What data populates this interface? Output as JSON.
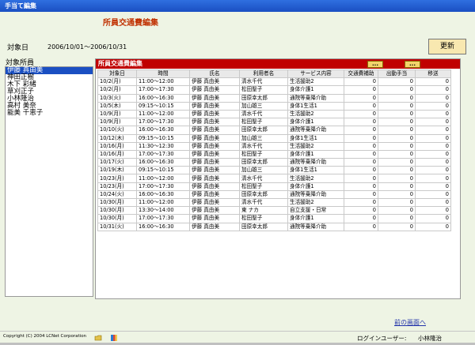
{
  "window": {
    "title": "手当て編集"
  },
  "page_title": "所員交通費編集",
  "period": {
    "label": "対象日",
    "value": "2006/10/01～2006/10/31"
  },
  "update_button": "更新",
  "staff": {
    "label": "対象所員",
    "items": [
      "伊藤 真由美",
      "神田正樹",
      "木下 彩緒",
      "草刈正子",
      "小林隆治",
      "高村 美奈",
      "能美 千恵子"
    ],
    "selected_index": 0
  },
  "panel": {
    "title": "所員交通費編集",
    "dots1": "...",
    "dots2": "..."
  },
  "table": {
    "headers": [
      "対象日",
      "時間",
      "氏名",
      "利用者名",
      "サービス内容",
      "交通費補助",
      "出動手当",
      "移送"
    ],
    "rows": [
      [
        "10/2(月)",
        "11:00～12:00",
        "伊藤 真由美",
        "清水千代",
        "生活援助2",
        "0",
        "0",
        "0"
      ],
      [
        "10/2(月)",
        "17:00～17:30",
        "伊藤 真由美",
        "松田聖子",
        "身体介護1",
        "0",
        "0",
        "0"
      ],
      [
        "10/3(火)",
        "16:00～16:30",
        "伊藤 真由美",
        "田原幸太郎",
        "通院等乗降介助",
        "0",
        "0",
        "0"
      ],
      [
        "10/5(木)",
        "09:15～10:15",
        "伊藤 真由美",
        "加山雄三",
        "身体1生活1",
        "0",
        "0",
        "0"
      ],
      [
        "10/9(月)",
        "11:00～12:00",
        "伊藤 真由美",
        "清水千代",
        "生活援助2",
        "0",
        "0",
        "0"
      ],
      [
        "10/9(月)",
        "17:00～17:30",
        "伊藤 真由美",
        "松田聖子",
        "身体介護1",
        "0",
        "0",
        "0"
      ],
      [
        "10/10(火)",
        "16:00～16:30",
        "伊藤 真由美",
        "田原幸太郎",
        "通院等乗降介助",
        "0",
        "0",
        "0"
      ],
      [
        "10/12(木)",
        "09:15～10:15",
        "伊藤 真由美",
        "加山雄三",
        "身体1生活1",
        "0",
        "0",
        "0"
      ],
      [
        "10/16(月)",
        "11:30～12:30",
        "伊藤 真由美",
        "清水千代",
        "生活援助2",
        "0",
        "0",
        "0"
      ],
      [
        "10/16(月)",
        "17:00～17:30",
        "伊藤 真由美",
        "松田聖子",
        "身体介護1",
        "0",
        "0",
        "0"
      ],
      [
        "10/17(火)",
        "16:00～16:30",
        "伊藤 真由美",
        "田原幸太郎",
        "通院等乗降介助",
        "0",
        "0",
        "0"
      ],
      [
        "10/19(木)",
        "09:15～10:15",
        "伊藤 真由美",
        "加山雄三",
        "身体1生活1",
        "0",
        "0",
        "0"
      ],
      [
        "10/23(月)",
        "11:00～12:00",
        "伊藤 真由美",
        "清水千代",
        "生活援助2",
        "0",
        "0",
        "0"
      ],
      [
        "10/23(月)",
        "17:00～17:30",
        "伊藤 真由美",
        "松田聖子",
        "身体介護1",
        "0",
        "0",
        "0"
      ],
      [
        "10/24(火)",
        "16:00～16:30",
        "伊藤 真由美",
        "田原幸太郎",
        "通院等乗降介助",
        "0",
        "0",
        "0"
      ],
      [
        "10/30(月)",
        "11:00～12:00",
        "伊藤 真由美",
        "清水千代",
        "生活援助2",
        "0",
        "0",
        "0"
      ],
      [
        "10/30(月)",
        "13:30～14:00",
        "伊藤 真由美",
        "東 ナカ",
        "自立支援・日常",
        "0",
        "0",
        "0"
      ],
      [
        "10/30(月)",
        "17:00～17:30",
        "伊藤 真由美",
        "松田聖子",
        "身体介護1",
        "0",
        "0",
        "0"
      ],
      [
        "10/31(火)",
        "16:00～16:30",
        "伊藤 真由美",
        "田原幸太郎",
        "通院等乗降介助",
        "0",
        "0",
        "0"
      ]
    ]
  },
  "footer": {
    "copyright": "Copyright (C) 2004 LCNet Corporation",
    "prev_link": "前の画面へ",
    "login_label": "ログインユーザー:",
    "login_user": "小林隆治"
  },
  "icons": {
    "folder": "folder-icon",
    "book": "book-icon"
  }
}
